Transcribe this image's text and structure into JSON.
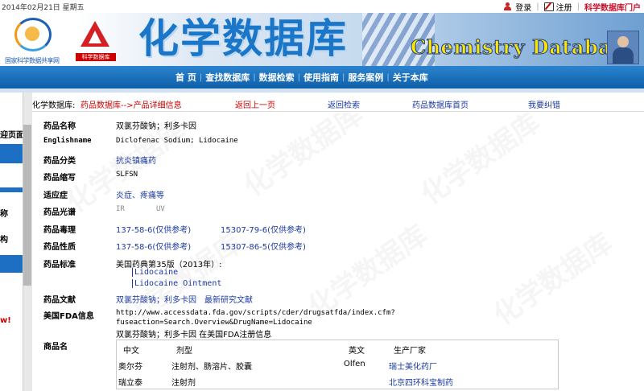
{
  "topbar": {
    "date": "2014年02月21日  星期五",
    "login": "登录",
    "register": "注册",
    "portal": "科学数据库门户"
  },
  "banner": {
    "logo1_caption": "国家科学数据共享网",
    "logo2_caption": "科学数据库",
    "title": "化学数据库",
    "english_title": "Chemistry Database"
  },
  "nav": {
    "items": [
      "首 页",
      "查找数据库",
      "数据检索",
      "使用指南",
      "服务案例",
      "关于本库"
    ]
  },
  "sidebar": {
    "stubs": [
      "迎页面",
      "称",
      "构",
      "w!"
    ]
  },
  "breadcrumb": {
    "home": "化学数据库:",
    "path": "药品数据库-->产品详细信息",
    "back": "返回上一页",
    "back_search": "返回检索",
    "db_home": "药品数据库首页",
    "report": "我要纠错"
  },
  "watermark": "化学数据库",
  "detail": {
    "name_label": "药品名称",
    "name_value": "双氯芬酸钠；利多卡因",
    "english_label": "Englishname",
    "english_value": "Diclofenac Sodium; Lidocaine",
    "category_label": "药品分类",
    "category_value": "抗炎镇痛药",
    "abbr_label": "药品缩写",
    "abbr_value": "SLFSN",
    "indication_label": "适应症",
    "indication_value": "炎症、疼痛等",
    "spectrum_label": "药品光谱",
    "spectrum_ir": "IR",
    "spectrum_uv": "UV",
    "toxicity_label": "药品毒理",
    "toxicity_1": "137-58-6(仅供参考)",
    "toxicity_2": "15307-79-6(仅供参考)",
    "property_label": "药品性质",
    "property_1": "137-58-6(仅供参考)",
    "property_2": "15307-86-5(仅供参考)",
    "standard_label": "药品标准",
    "standard_source": "美国药典第35版（2013年）:",
    "standard_items": [
      "Lidocaine",
      "Lidocaine Ointment"
    ],
    "literature_label": "药品文献",
    "literature_1": "双氯芬酸钠；利多卡因",
    "literature_2": "最新研究文献",
    "fda_label": "美国FDA信息",
    "fda_url_1": "http://www.accessdata.fda.gov/scripts/cder/drugsatfda/index.cfm?",
    "fda_url_2": "fuseaction=Search.Overview&DrugName=Lidocaine",
    "fda_note": "双氯芬酸钠；利多卡因 在美国FDA注册信息",
    "trade_label": "商品名",
    "trade_headers": [
      "中文",
      "剂型",
      "英文",
      "生产厂家"
    ],
    "trade_rows": [
      [
        "奥尔芬",
        "注射剂、肠溶片、胶囊",
        "Olfen",
        "瑞士美化药厂"
      ],
      [
        "瑞立泰",
        "注射剂",
        "",
        "北京四环科宝制药"
      ]
    ]
  }
}
